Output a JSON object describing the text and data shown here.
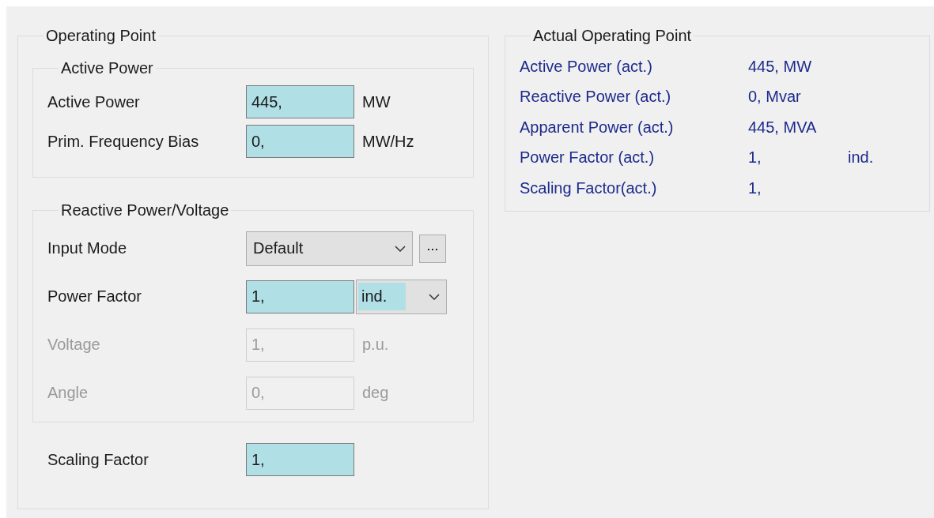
{
  "operating_point": {
    "title": "Operating Point",
    "active_power": {
      "title": "Active Power",
      "rows": [
        {
          "kind": "input",
          "label": "Active Power",
          "value": "445,",
          "unit": "MW",
          "disabled": false
        },
        {
          "kind": "input",
          "label": "Prim. Frequency Bias",
          "value": "0,",
          "unit": "MW/Hz",
          "disabled": false
        }
      ]
    },
    "reactive": {
      "title": "Reactive Power/Voltage",
      "rows": [
        {
          "kind": "combo",
          "label": "Input Mode",
          "value": "Default",
          "button": "..."
        },
        {
          "kind": "input_combo",
          "label": "Power Factor",
          "value": "1,",
          "option": "ind."
        },
        {
          "kind": "input",
          "label": "Voltage",
          "value": "1,",
          "unit": "p.u.",
          "disabled": true
        },
        {
          "kind": "input",
          "label": "Angle",
          "value": "0,",
          "unit": "deg",
          "disabled": true
        }
      ]
    },
    "scaling": {
      "label": "Scaling Factor",
      "value": "1,",
      "disabled": false
    }
  },
  "actual": {
    "title": "Actual Operating Point",
    "rows": [
      {
        "label": "Active Power (act.)",
        "value": "445, MW"
      },
      {
        "label": "Reactive Power (act.)",
        "value": "0, Mvar"
      },
      {
        "label": "Apparent Power (act.)",
        "value": "445, MVA"
      },
      {
        "label": "Power Factor (act.)",
        "value": "1,",
        "suffix": "ind."
      },
      {
        "label": "Scaling Factor(act.)",
        "value": "1,"
      }
    ]
  }
}
